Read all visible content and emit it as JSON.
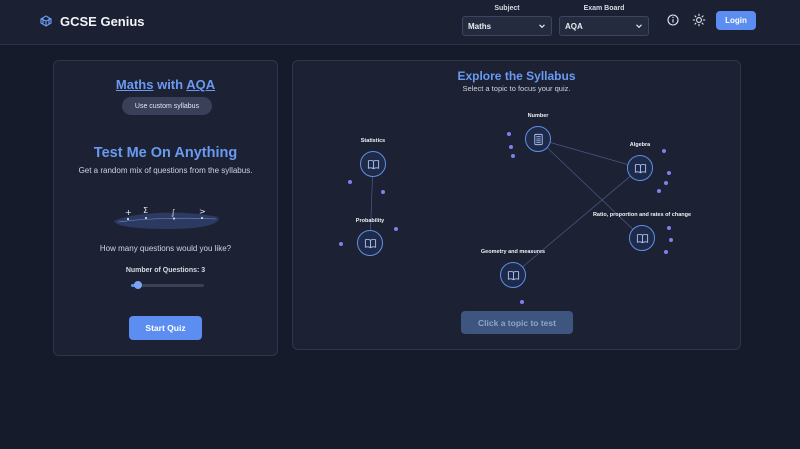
{
  "app": {
    "name": "GCSE Genius"
  },
  "header": {
    "subject": {
      "label": "Subject",
      "value": "Maths"
    },
    "exam_board": {
      "label": "Exam Board",
      "value": "AQA"
    },
    "login_label": "Login"
  },
  "left_panel": {
    "course_subject": "Maths",
    "course_with": "with",
    "course_board": "AQA",
    "custom_syllabus_label": "Use custom syllabus",
    "test_title": "Test Me On Anything",
    "test_subtitle": "Get a random mix of questions from the syllabus.",
    "deco_symbols": [
      "+",
      "Σ",
      "∫",
      ">"
    ],
    "how_many": "How many questions would you like?",
    "num_questions_label": "Number of Questions:",
    "num_questions_value": 3,
    "num_questions_range": [
      3,
      30
    ],
    "start_label": "Start Quiz"
  },
  "right_panel": {
    "title": "Explore the Syllabus",
    "subtitle": "Select a topic to focus your quiz.",
    "topics": [
      {
        "id": "statistics",
        "label": "Statistics"
      },
      {
        "id": "probability",
        "label": "Probability"
      },
      {
        "id": "number",
        "label": "Number"
      },
      {
        "id": "algebra",
        "label": "Algebra"
      },
      {
        "id": "ratio",
        "label": "Ratio, proportion and rates of change"
      },
      {
        "id": "geometry",
        "label": "Geometry and measures"
      }
    ],
    "click_label": "Click a topic to test"
  },
  "colors": {
    "accent": "#5b8ef0",
    "title_blue": "#6a9af2",
    "background": "#161b2c",
    "panel": "#1c2233",
    "dot": "#7f80ee"
  }
}
